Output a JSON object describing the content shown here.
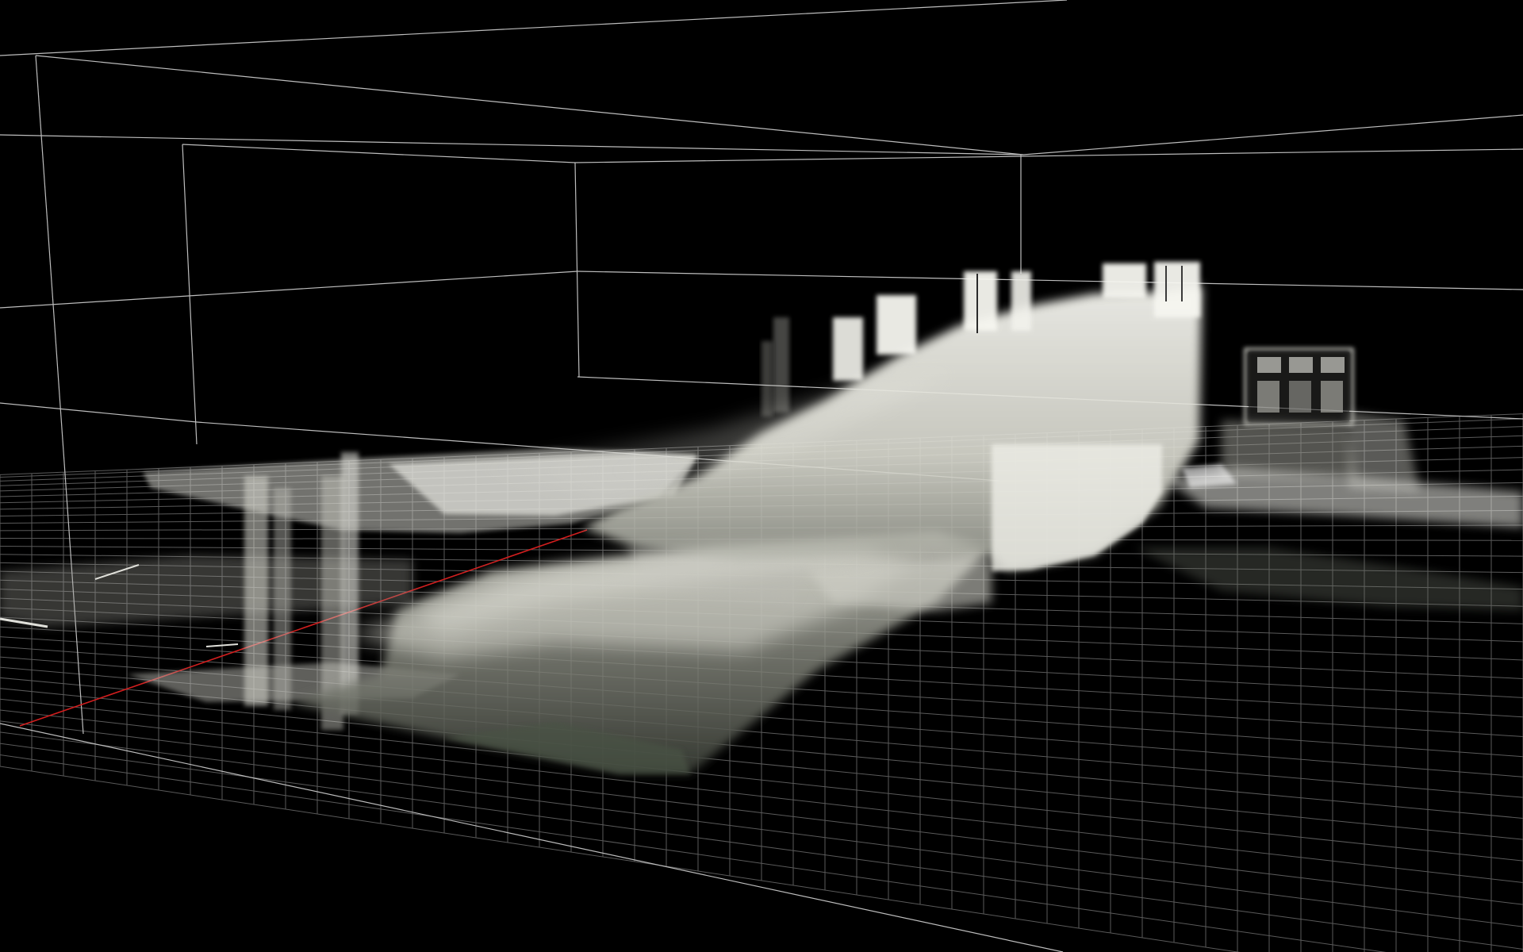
{
  "viewer": {
    "background_color": "#000000",
    "wireframe_color": "#bdbdbd",
    "grid_color": "#5a5a5a",
    "axis_x_color": "#d21e1e",
    "point_cloud_color": "#f2f2ec",
    "point_cloud_shadow_color": "#2e322c",
    "grid_visible": true,
    "bounding_box_visible": true,
    "axis_line_visible": true
  }
}
